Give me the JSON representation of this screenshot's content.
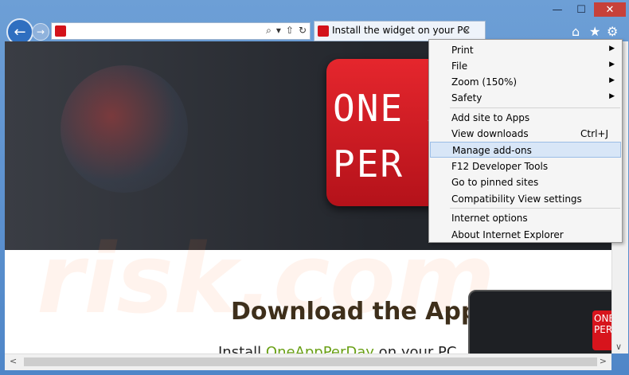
{
  "window": {
    "min": "—",
    "max": "☐",
    "close": "✕"
  },
  "nav": {
    "back": "←",
    "forward": "→"
  },
  "address": {
    "value": "",
    "icons": [
      "⌕",
      "▾",
      "⇧",
      "↻"
    ]
  },
  "tab": {
    "title": "Install the widget on your PC",
    "close": "×"
  },
  "toolbar": {
    "home": "⌂",
    "favorites": "★",
    "tools": "⚙"
  },
  "page": {
    "logo_line1": "ONE A",
    "logo_line2": "PER DA",
    "watermark": "risk.com",
    "heading": "Download the App",
    "install_prefix": "Install ",
    "install_link": "OneAppPerDay",
    "install_suffix": " on your PC",
    "device_logo": "ONE PER"
  },
  "menu": {
    "items": [
      {
        "label": "Print",
        "submenu": true
      },
      {
        "label": "File",
        "submenu": true
      },
      {
        "label": "Zoom (150%)",
        "submenu": true
      },
      {
        "label": "Safety",
        "submenu": true
      },
      {
        "label": "Add site to Apps"
      },
      {
        "label": "View downloads",
        "shortcut": "Ctrl+J"
      },
      {
        "label": "Manage add-ons",
        "highlighted": true
      },
      {
        "label": "F12 Developer Tools"
      },
      {
        "label": "Go to pinned sites"
      },
      {
        "label": "Compatibility View settings"
      },
      {
        "label": "Internet options"
      },
      {
        "label": "About Internet Explorer"
      }
    ],
    "arrow": "▶"
  },
  "scroll": {
    "left": "<",
    "right": ">",
    "down": "∨"
  }
}
